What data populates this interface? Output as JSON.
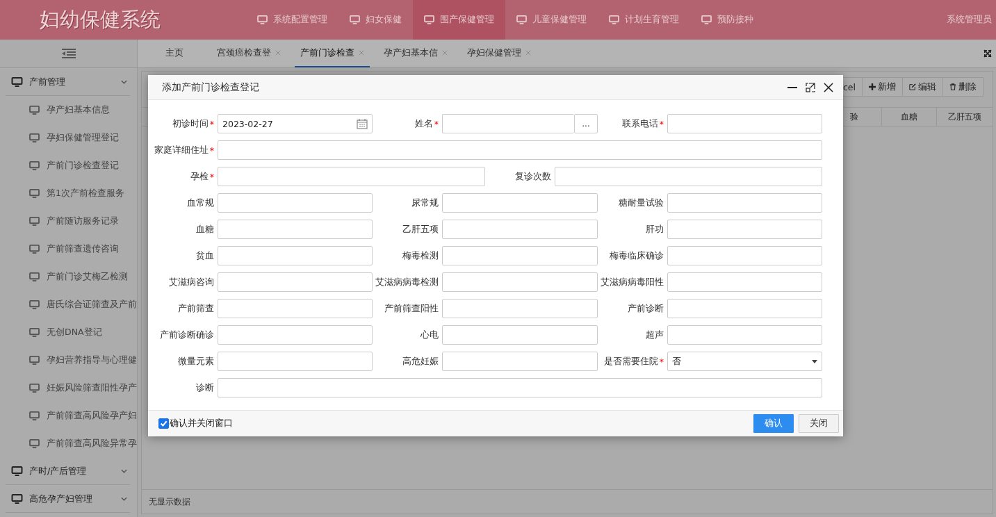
{
  "header": {
    "title": "妇幼保健系统",
    "user": "系统管理员",
    "nav": [
      {
        "label": "系统配置管理",
        "selected": false
      },
      {
        "label": "妇女保健",
        "selected": false
      },
      {
        "label": "围产保健管理",
        "selected": true
      },
      {
        "label": "儿童保健管理",
        "selected": false
      },
      {
        "label": "计划生育管理",
        "selected": false
      },
      {
        "label": "预防接种",
        "selected": false
      }
    ]
  },
  "sidebar": {
    "groups": [
      {
        "label": "产前管理",
        "children": [
          "孕产妇基本信息",
          "孕妇保健管理登记",
          "产前门诊检查登记",
          "第1次产前检查服务",
          "产前随访服务记录",
          "产前筛查遗传咨询",
          "产前门诊艾梅乙检测",
          "唐氏综合证筛查及产前",
          "无创DNA登记",
          "孕妇营养指导与心理健",
          "妊娠风险筛查阳性孕产",
          "产前筛查高风险孕产妇",
          "产前筛查高风险异常孕"
        ]
      },
      {
        "label": "产时/产后管理"
      },
      {
        "label": "高危孕产妇管理"
      }
    ]
  },
  "tabs": [
    {
      "label": "主页",
      "selected": false,
      "closable": false
    },
    {
      "label": "宫颈癌检查登",
      "selected": false,
      "closable": true
    },
    {
      "label": "产前门诊检查",
      "selected": true,
      "closable": true
    },
    {
      "label": "孕产妇基本信",
      "selected": false,
      "closable": true
    },
    {
      "label": "孕妇保健管理",
      "selected": false,
      "closable": true
    }
  ],
  "toolbar": [
    {
      "label": "cel",
      "kind": "plain"
    },
    {
      "label": "新增",
      "kind": "add"
    },
    {
      "label": "编辑",
      "kind": "edit"
    },
    {
      "label": "删除",
      "kind": "delete"
    }
  ],
  "table": {
    "columns": [
      "验",
      "血糖",
      "乙肝五项"
    ],
    "empty_text": "无显示数据"
  },
  "dialog": {
    "title": "添加产前门诊检查登记",
    "rows": [
      {
        "fields": [
          {
            "label": "初诊时间",
            "required_mark": "*",
            "kind": "date",
            "value": "2023-02-27"
          },
          {
            "label": "姓名",
            "required_mark": "*",
            "kind": "picker",
            "button": "..."
          },
          {
            "label": "联系电话",
            "required_mark": "*",
            "kind": "text"
          }
        ]
      },
      {
        "fields": [
          {
            "label": "家庭详细住址",
            "required_mark": "*",
            "kind": "text"
          }
        ]
      },
      {
        "fields": [
          {
            "label": "孕检",
            "required_mark": "*",
            "kind": "text"
          },
          {
            "label": "复诊次数",
            "kind": "text"
          }
        ]
      },
      {
        "fields": [
          {
            "label": "血常规",
            "kind": "text"
          },
          {
            "label": "尿常规",
            "kind": "text"
          },
          {
            "label": "糖耐量试验",
            "kind": "text"
          }
        ]
      },
      {
        "fields": [
          {
            "label": "血糖",
            "kind": "text"
          },
          {
            "label": "乙肝五项",
            "kind": "text"
          },
          {
            "label": "肝功",
            "kind": "text"
          }
        ]
      },
      {
        "fields": [
          {
            "label": "贫血",
            "kind": "text"
          },
          {
            "label": "梅毒检测",
            "kind": "text"
          },
          {
            "label": "梅毒临床确诊",
            "kind": "text"
          }
        ]
      },
      {
        "fields": [
          {
            "label": "艾滋病咨询",
            "kind": "text"
          },
          {
            "label": "艾滋病病毒检测",
            "kind": "text"
          },
          {
            "label": "艾滋病病毒阳性",
            "kind": "text"
          }
        ]
      },
      {
        "fields": [
          {
            "label": "产前筛查",
            "kind": "text"
          },
          {
            "label": "产前筛查阳性",
            "kind": "text"
          },
          {
            "label": "产前诊断",
            "kind": "text"
          }
        ]
      },
      {
        "fields": [
          {
            "label": "产前诊断确诊",
            "kind": "text"
          },
          {
            "label": "心电",
            "kind": "text"
          },
          {
            "label": "超声",
            "kind": "text"
          }
        ]
      },
      {
        "fields": [
          {
            "label": "微量元素",
            "kind": "text"
          },
          {
            "label": "高危妊娠",
            "kind": "text"
          },
          {
            "label": "是否需要住院",
            "required_mark": "*",
            "kind": "select",
            "value": "否"
          }
        ]
      },
      {
        "fields": [
          {
            "label": "诊断",
            "kind": "text"
          }
        ]
      }
    ],
    "close_after_confirm": {
      "label": "确认并关闭窗口",
      "checked": true
    },
    "buttons": [
      {
        "label": "确认",
        "kind": "primary"
      },
      {
        "label": "关闭",
        "kind": "default"
      }
    ]
  }
}
